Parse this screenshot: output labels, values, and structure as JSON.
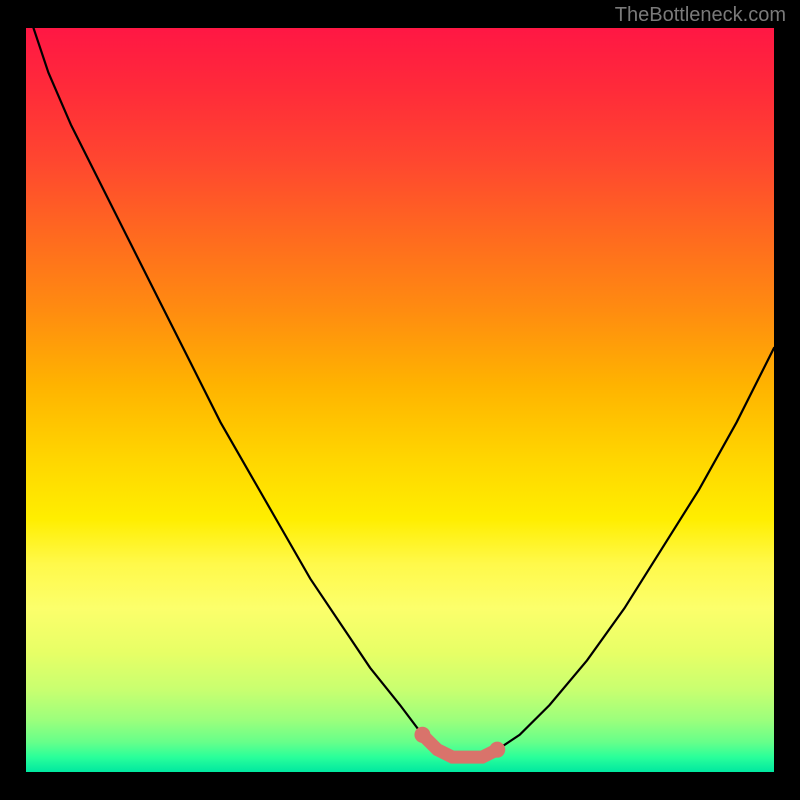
{
  "attribution": "TheBottleneck.com",
  "chart_data": {
    "type": "line",
    "title": "",
    "xlabel": "",
    "ylabel": "",
    "xlim": [
      0,
      100
    ],
    "ylim": [
      0,
      100
    ],
    "series": [
      {
        "name": "bottleneck-curve",
        "x": [
          1,
          3,
          6,
          10,
          14,
          18,
          22,
          26,
          30,
          34,
          38,
          42,
          46,
          50,
          53,
          55,
          57,
          59,
          61,
          63,
          66,
          70,
          75,
          80,
          85,
          90,
          95,
          100
        ],
        "y": [
          100,
          94,
          87,
          79,
          71,
          63,
          55,
          47,
          40,
          33,
          26,
          20,
          14,
          9,
          5,
          3,
          2,
          2,
          2,
          3,
          5,
          9,
          15,
          22,
          30,
          38,
          47,
          57
        ]
      }
    ],
    "annotations": [
      {
        "name": "trough-highlight",
        "x_range": [
          52,
          63
        ],
        "color": "#d9736b"
      }
    ],
    "gradient_stops": [
      {
        "pos": 0,
        "color": "#ff1744"
      },
      {
        "pos": 50,
        "color": "#ffd600"
      },
      {
        "pos": 100,
        "color": "#00e8a0"
      }
    ]
  }
}
